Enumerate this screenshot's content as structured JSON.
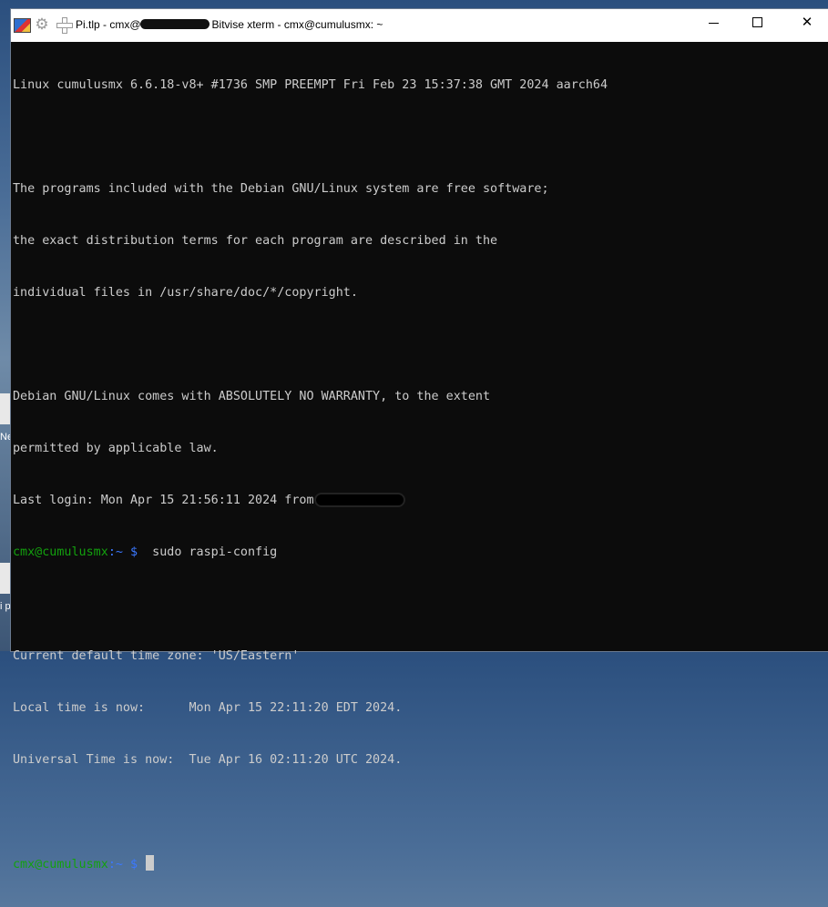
{
  "desktop": {
    "fragment_text_1": "Ne",
    "fragment_text_2": "i p"
  },
  "window": {
    "title_prefix": "Pi.tlp - cmx@",
    "title_suffix": "Bitvise xterm - cmx@cumulusmx: ~",
    "buttons": {
      "minimize": "",
      "maximize": "",
      "close": "✕"
    }
  },
  "terminal": {
    "lines": [
      "Linux cumulusmx 6.6.18-v8+ #1736 SMP PREEMPT Fri Feb 23 15:37:38 GMT 2024 aarch64",
      "",
      "The programs included with the Debian GNU/Linux system are free software;",
      "the exact distribution terms for each program are described in the",
      "individual files in /usr/share/doc/*/copyright.",
      "",
      "Debian GNU/Linux comes with ABSOLUTELY NO WARRANTY, to the extent",
      "permitted by applicable law."
    ],
    "last_login": "Last login: Mon Apr 15 21:56:11 2024 from",
    "prompt_user": "cmx@cumulusmx",
    "prompt_path": ":~ $",
    "command_1": "  sudo raspi-config",
    "output_lines": [
      "",
      "Current default time zone: 'US/Eastern'",
      "Local time is now:      Mon Apr 15 22:11:20 EDT 2024.",
      "Universal Time is now:  Tue Apr 16 02:11:20 UTC 2024.",
      ""
    ]
  },
  "icons": [
    "app-icon",
    "gear-icon",
    "plus-icon"
  ]
}
